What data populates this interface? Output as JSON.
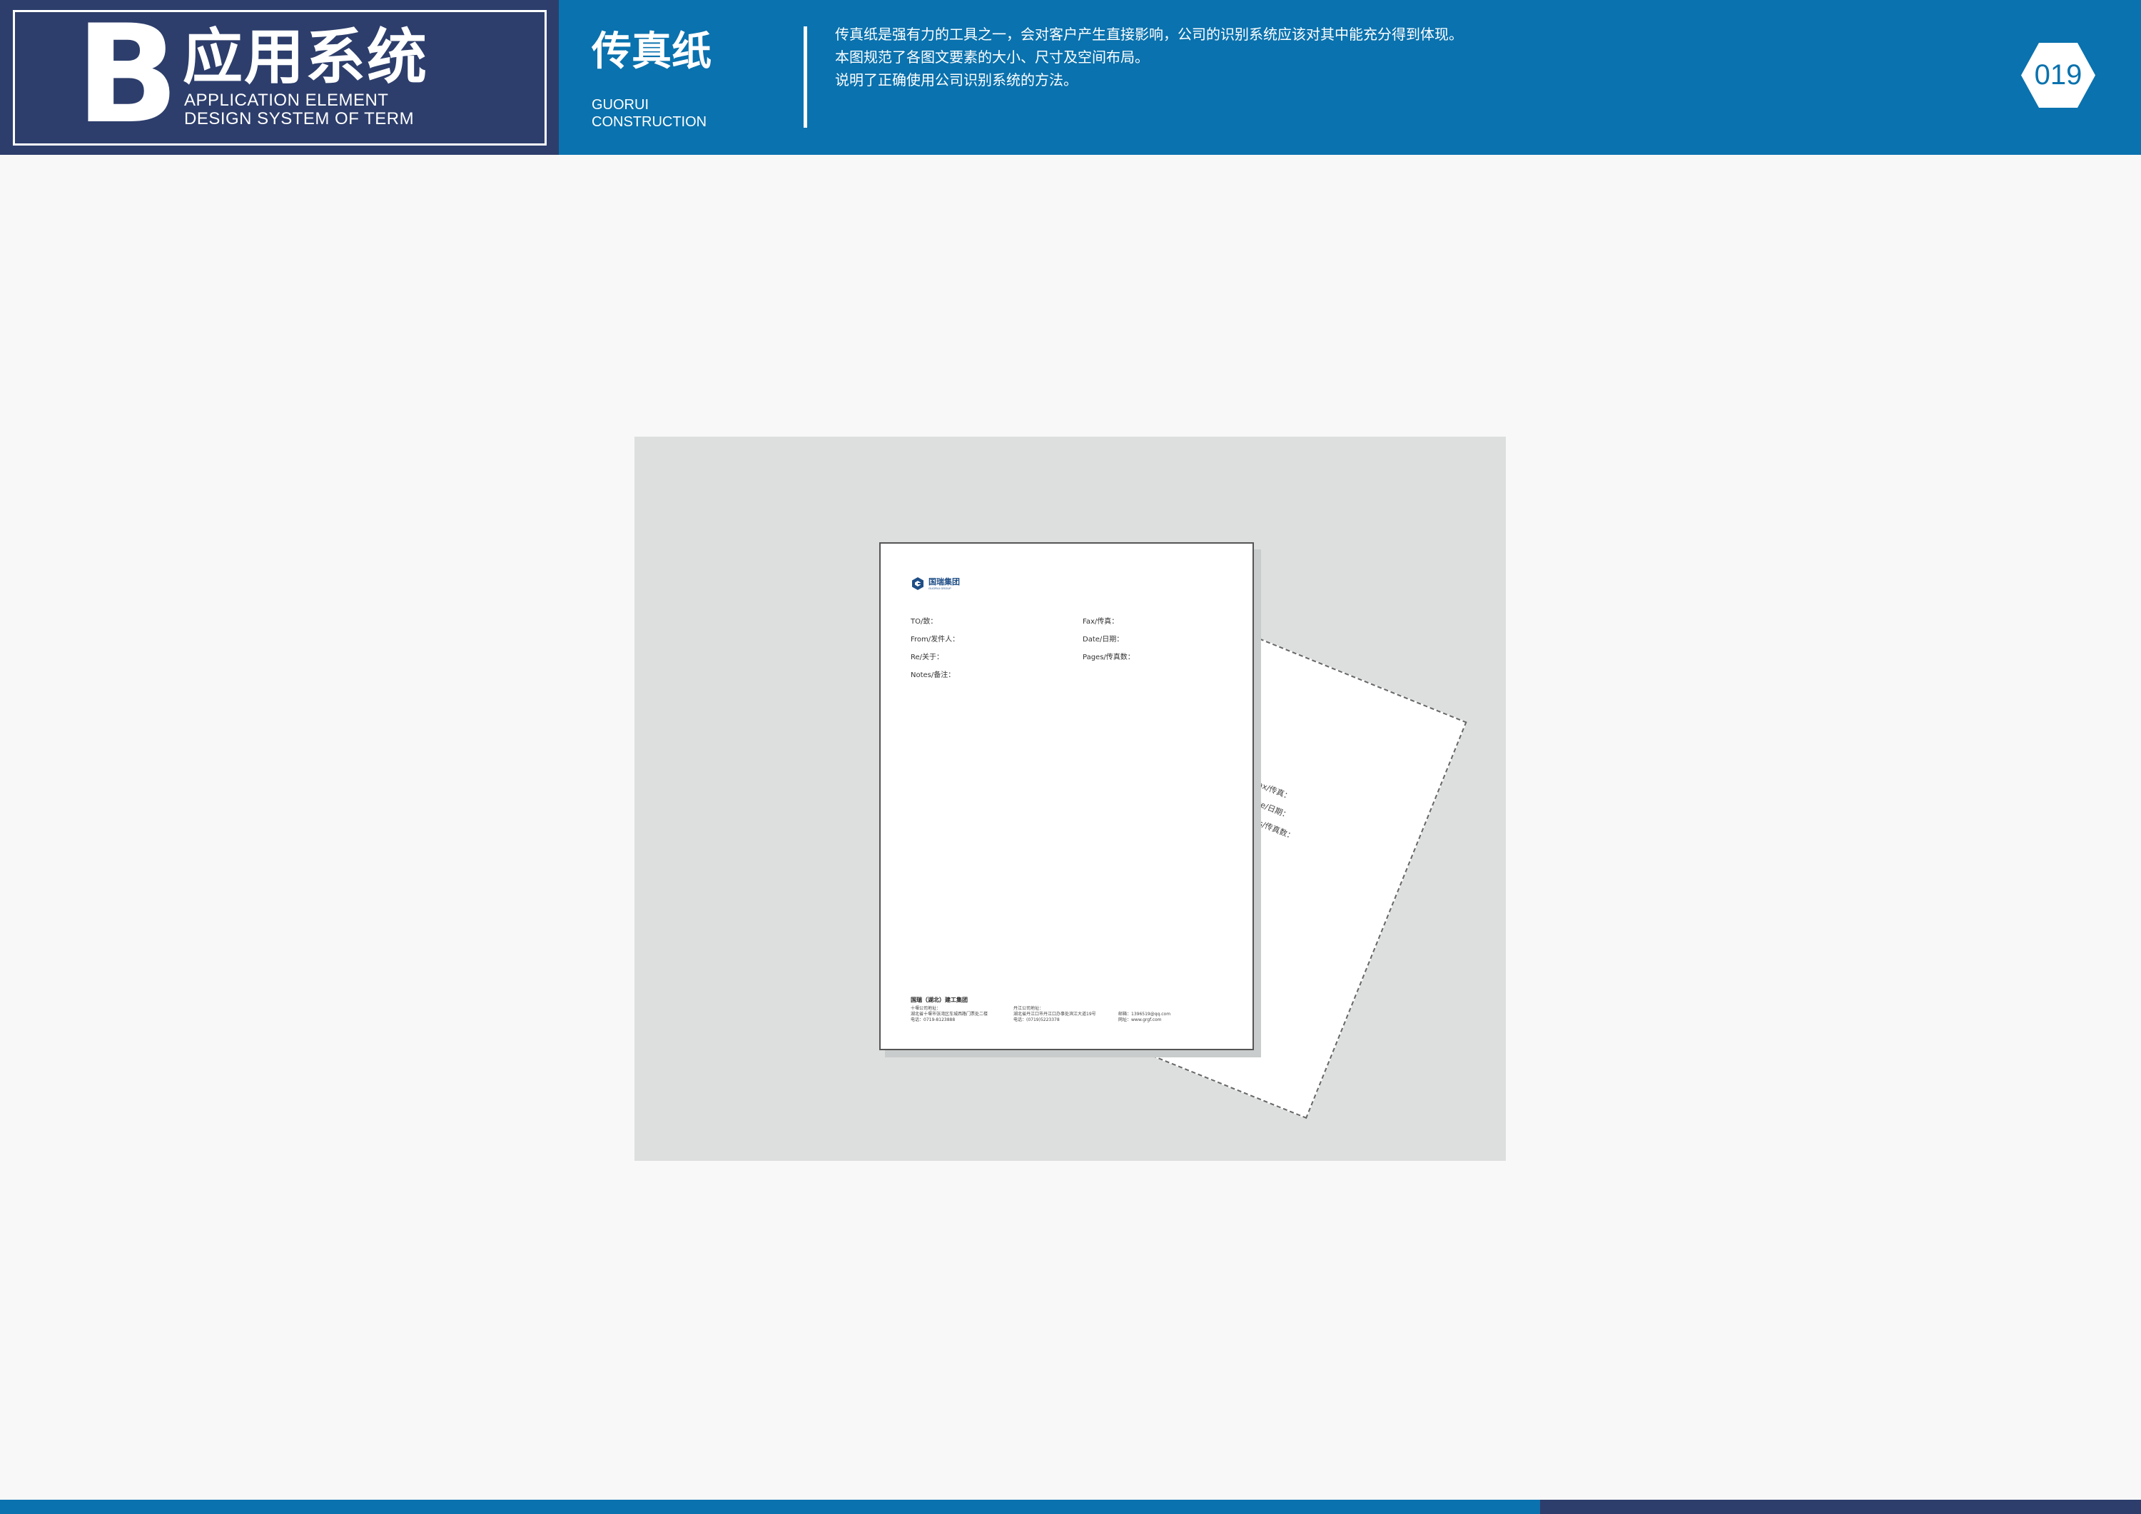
{
  "header": {
    "section_letter": "B",
    "section_title_cn": "应用系统",
    "section_title_en_line1": "APPLICATION ELEMENT",
    "section_title_en_line2": "DESIGN SYSTEM OF TERM",
    "item_title_cn": "传真纸",
    "item_title_en_line1": "GUORUI",
    "item_title_en_line2": "CONSTRUCTION",
    "description": [
      "传真纸是强有力的工具之一，会对客户产生直接影响，公司的识别系统应该对其中能充分得到体现。",
      "本图规范了各图文要素的大小、尺寸及空间布局。",
      "说明了正确使用公司识别系统的方法。"
    ],
    "page_number": "019"
  },
  "fax_sheet": {
    "logo_name": "国瑞集团",
    "logo_sub": "GUORUI GROUP",
    "left_fields": [
      "TO/致：",
      "From/发件人：",
      "Re/关于：",
      "Notes/备注："
    ],
    "right_fields": [
      "Fax/传真：",
      "Date/日期：",
      "Pages/传真数："
    ],
    "footer_title": "国瑞（湖北）建工集团",
    "footer_col1": [
      "十堰公司地址：",
      "湖北省十堰市张湾区车城西路门票处二楼",
      "电话：0719-8123888"
    ],
    "footer_col2": [
      "丹江公司地址：",
      "湖北省丹江口市丹江口办事处滨江大道19号",
      "电话：(0719)5223378"
    ],
    "footer_col3": [
      "邮箱：1396519@qq.com",
      "网址：www.grgf.com"
    ]
  },
  "colors": {
    "header_blue": "#0a72ae",
    "header_navy": "#2d3e6c",
    "mockup_bg": "#dcdfde",
    "page_bg": "#f8f8f8"
  }
}
